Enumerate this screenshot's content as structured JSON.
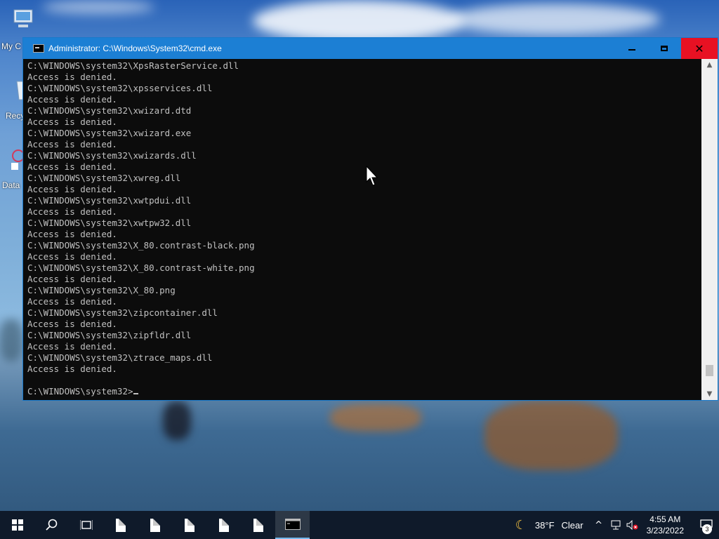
{
  "desktop": {
    "icons": [
      {
        "label": "My C",
        "icon": "computer-icon"
      },
      {
        "label": "Recy",
        "icon": "recycle-bin-icon"
      },
      {
        "label": "Data",
        "icon": "app-shortcut-icon"
      }
    ]
  },
  "window": {
    "title": "Administrator: C:\\Windows\\System32\\cmd.exe",
    "buttons": {
      "minimize": "minimize-icon",
      "maximize": "maximize-icon",
      "close": "✕"
    },
    "scrollbar": {
      "up": "▲",
      "down": "▼"
    }
  },
  "console": {
    "lines": [
      "C:\\WINDOWS\\system32\\XpsRasterService.dll",
      "Access is denied.",
      "C:\\WINDOWS\\system32\\xpsservices.dll",
      "Access is denied.",
      "C:\\WINDOWS\\system32\\xwizard.dtd",
      "Access is denied.",
      "C:\\WINDOWS\\system32\\xwizard.exe",
      "Access is denied.",
      "C:\\WINDOWS\\system32\\xwizards.dll",
      "Access is denied.",
      "C:\\WINDOWS\\system32\\xwreg.dll",
      "Access is denied.",
      "C:\\WINDOWS\\system32\\xwtpdui.dll",
      "Access is denied.",
      "C:\\WINDOWS\\system32\\xwtpw32.dll",
      "Access is denied.",
      "C:\\WINDOWS\\system32\\X_80.contrast-black.png",
      "Access is denied.",
      "C:\\WINDOWS\\system32\\X_80.contrast-white.png",
      "Access is denied.",
      "C:\\WINDOWS\\system32\\X_80.png",
      "Access is denied.",
      "C:\\WINDOWS\\system32\\zipcontainer.dll",
      "Access is denied.",
      "C:\\WINDOWS\\system32\\zipfldr.dll",
      "Access is denied.",
      "C:\\WINDOWS\\system32\\ztrace_maps.dll",
      "Access is denied.",
      ""
    ],
    "prompt": "C:\\WINDOWS\\system32>"
  },
  "taskbar": {
    "start": "windows-start-icon",
    "search": "search-icon",
    "task_view": "task-view-icon",
    "pinned_files": [
      "file-icon",
      "file-icon",
      "file-icon",
      "file-icon",
      "file-icon"
    ],
    "active_app": "cmd-icon",
    "weather": {
      "temp": "38°F",
      "condition": "Clear"
    },
    "tray_chevron": "^",
    "clock": {
      "time": "4:55 AM",
      "date": "3/23/2022"
    },
    "notification_count": "3"
  },
  "colors": {
    "titlebar": "#1c7fd4",
    "console_bg": "#0c0c0c",
    "console_text": "#c0c0c0",
    "close": "#e81123",
    "taskbar": "#0f1a2a"
  }
}
